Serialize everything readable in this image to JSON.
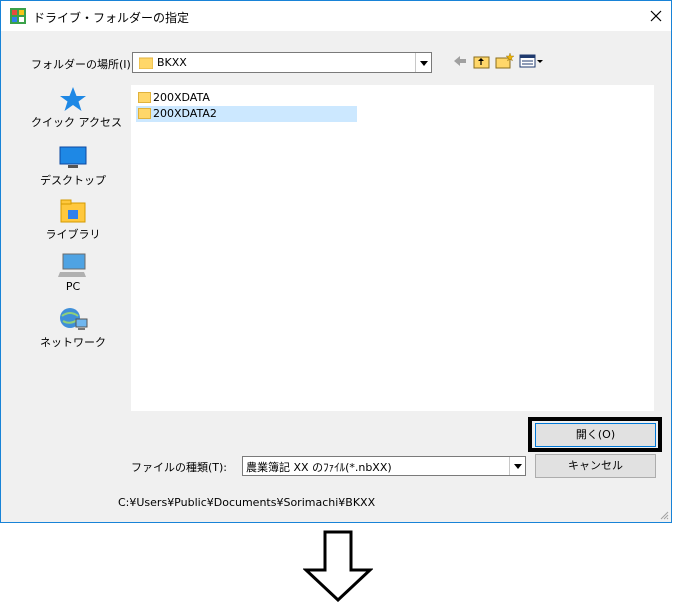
{
  "window": {
    "title": "ドライブ・フォルダーの指定"
  },
  "lookin": {
    "label": "フォルダーの場所(I):",
    "value": "BKXX"
  },
  "places": [
    {
      "label": "クイック アクセス",
      "icon": "star-icon"
    },
    {
      "label": "デスクトップ",
      "icon": "desktop-icon"
    },
    {
      "label": "ライブラリ",
      "icon": "library-icon"
    },
    {
      "label": "PC",
      "icon": "pc-icon"
    },
    {
      "label": "ネットワーク",
      "icon": "network-icon"
    }
  ],
  "files": [
    {
      "name": "200XDATA",
      "selected": false
    },
    {
      "name": "200XDATA2",
      "selected": true
    }
  ],
  "filetype": {
    "label": "ファイルの種類(T):",
    "value": "農業簿記 XX のﾌｧｲﾙ(*.nbXX)"
  },
  "buttons": {
    "open": "開く(O)",
    "cancel": "キャンセル"
  },
  "path": "C:¥Users¥Public¥Documents¥Sorimachi¥BKXX"
}
